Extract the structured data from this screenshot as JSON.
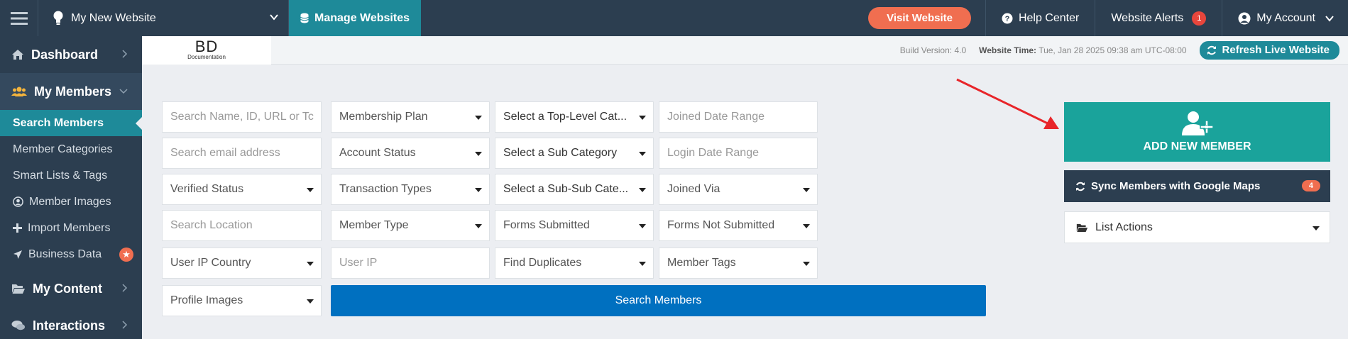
{
  "topbar": {
    "site_name": "My New Website",
    "manage_label": "Manage Websites",
    "visit_label": "Visit Website",
    "help_label": "Help Center",
    "alerts_label": "Website Alerts",
    "alerts_count": "1",
    "account_label": "My Account"
  },
  "sidebar": {
    "dashboard": "Dashboard",
    "my_members": "My Members",
    "items": [
      {
        "label": "Search Members",
        "icon": "none"
      },
      {
        "label": "Member Categories",
        "icon": "none"
      },
      {
        "label": "Smart Lists & Tags",
        "icon": "none"
      },
      {
        "label": "Member Images",
        "icon": "user-circle-icon"
      },
      {
        "label": "Import Members",
        "icon": "plus-icon"
      },
      {
        "label": "Business Data",
        "icon": "location-arrow-icon"
      }
    ],
    "my_content": "My Content",
    "interactions": "Interactions"
  },
  "subheader": {
    "logo_text": "BD",
    "logo_sub": "Documentation",
    "build_label": "Build Version: 4.0",
    "time_label": "Website Time:",
    "time_value": "Tue, Jan 28 2025 09:38 am UTC-08:00",
    "refresh_label": "Refresh Live Website"
  },
  "filters": {
    "search_name": "Search Name, ID, URL or Tc",
    "membership_plan": "Membership Plan",
    "top_category": "Select a Top-Level Cat...",
    "joined_date": "Joined Date Range",
    "search_email": "Search email address",
    "account_status": "Account Status",
    "sub_category": "Select a Sub Category",
    "login_date": "Login Date Range",
    "verified_status": "Verified Status",
    "transaction_types": "Transaction Types",
    "sub_sub_category": "Select a Sub-Sub Cate...",
    "joined_via": "Joined Via",
    "search_location": "Search Location",
    "member_type": "Member Type",
    "forms_submitted": "Forms Submitted",
    "forms_not_submitted": "Forms Not Submitted",
    "user_ip_country": "User IP Country",
    "user_ip": "User IP",
    "find_duplicates": "Find Duplicates",
    "member_tags": "Member Tags",
    "profile_images": "Profile Images",
    "search_button": "Search Members"
  },
  "actions": {
    "add_member": "ADD NEW MEMBER",
    "sync_label": "Sync Members with Google Maps",
    "sync_count": "4",
    "list_actions": "List Actions"
  },
  "colors": {
    "navy": "#2c3e50",
    "teal": "#1e8a99",
    "add_green": "#1aa39b",
    "orange": "#f06e50",
    "blue": "#0070c0",
    "red_arrow": "#e8252a"
  }
}
